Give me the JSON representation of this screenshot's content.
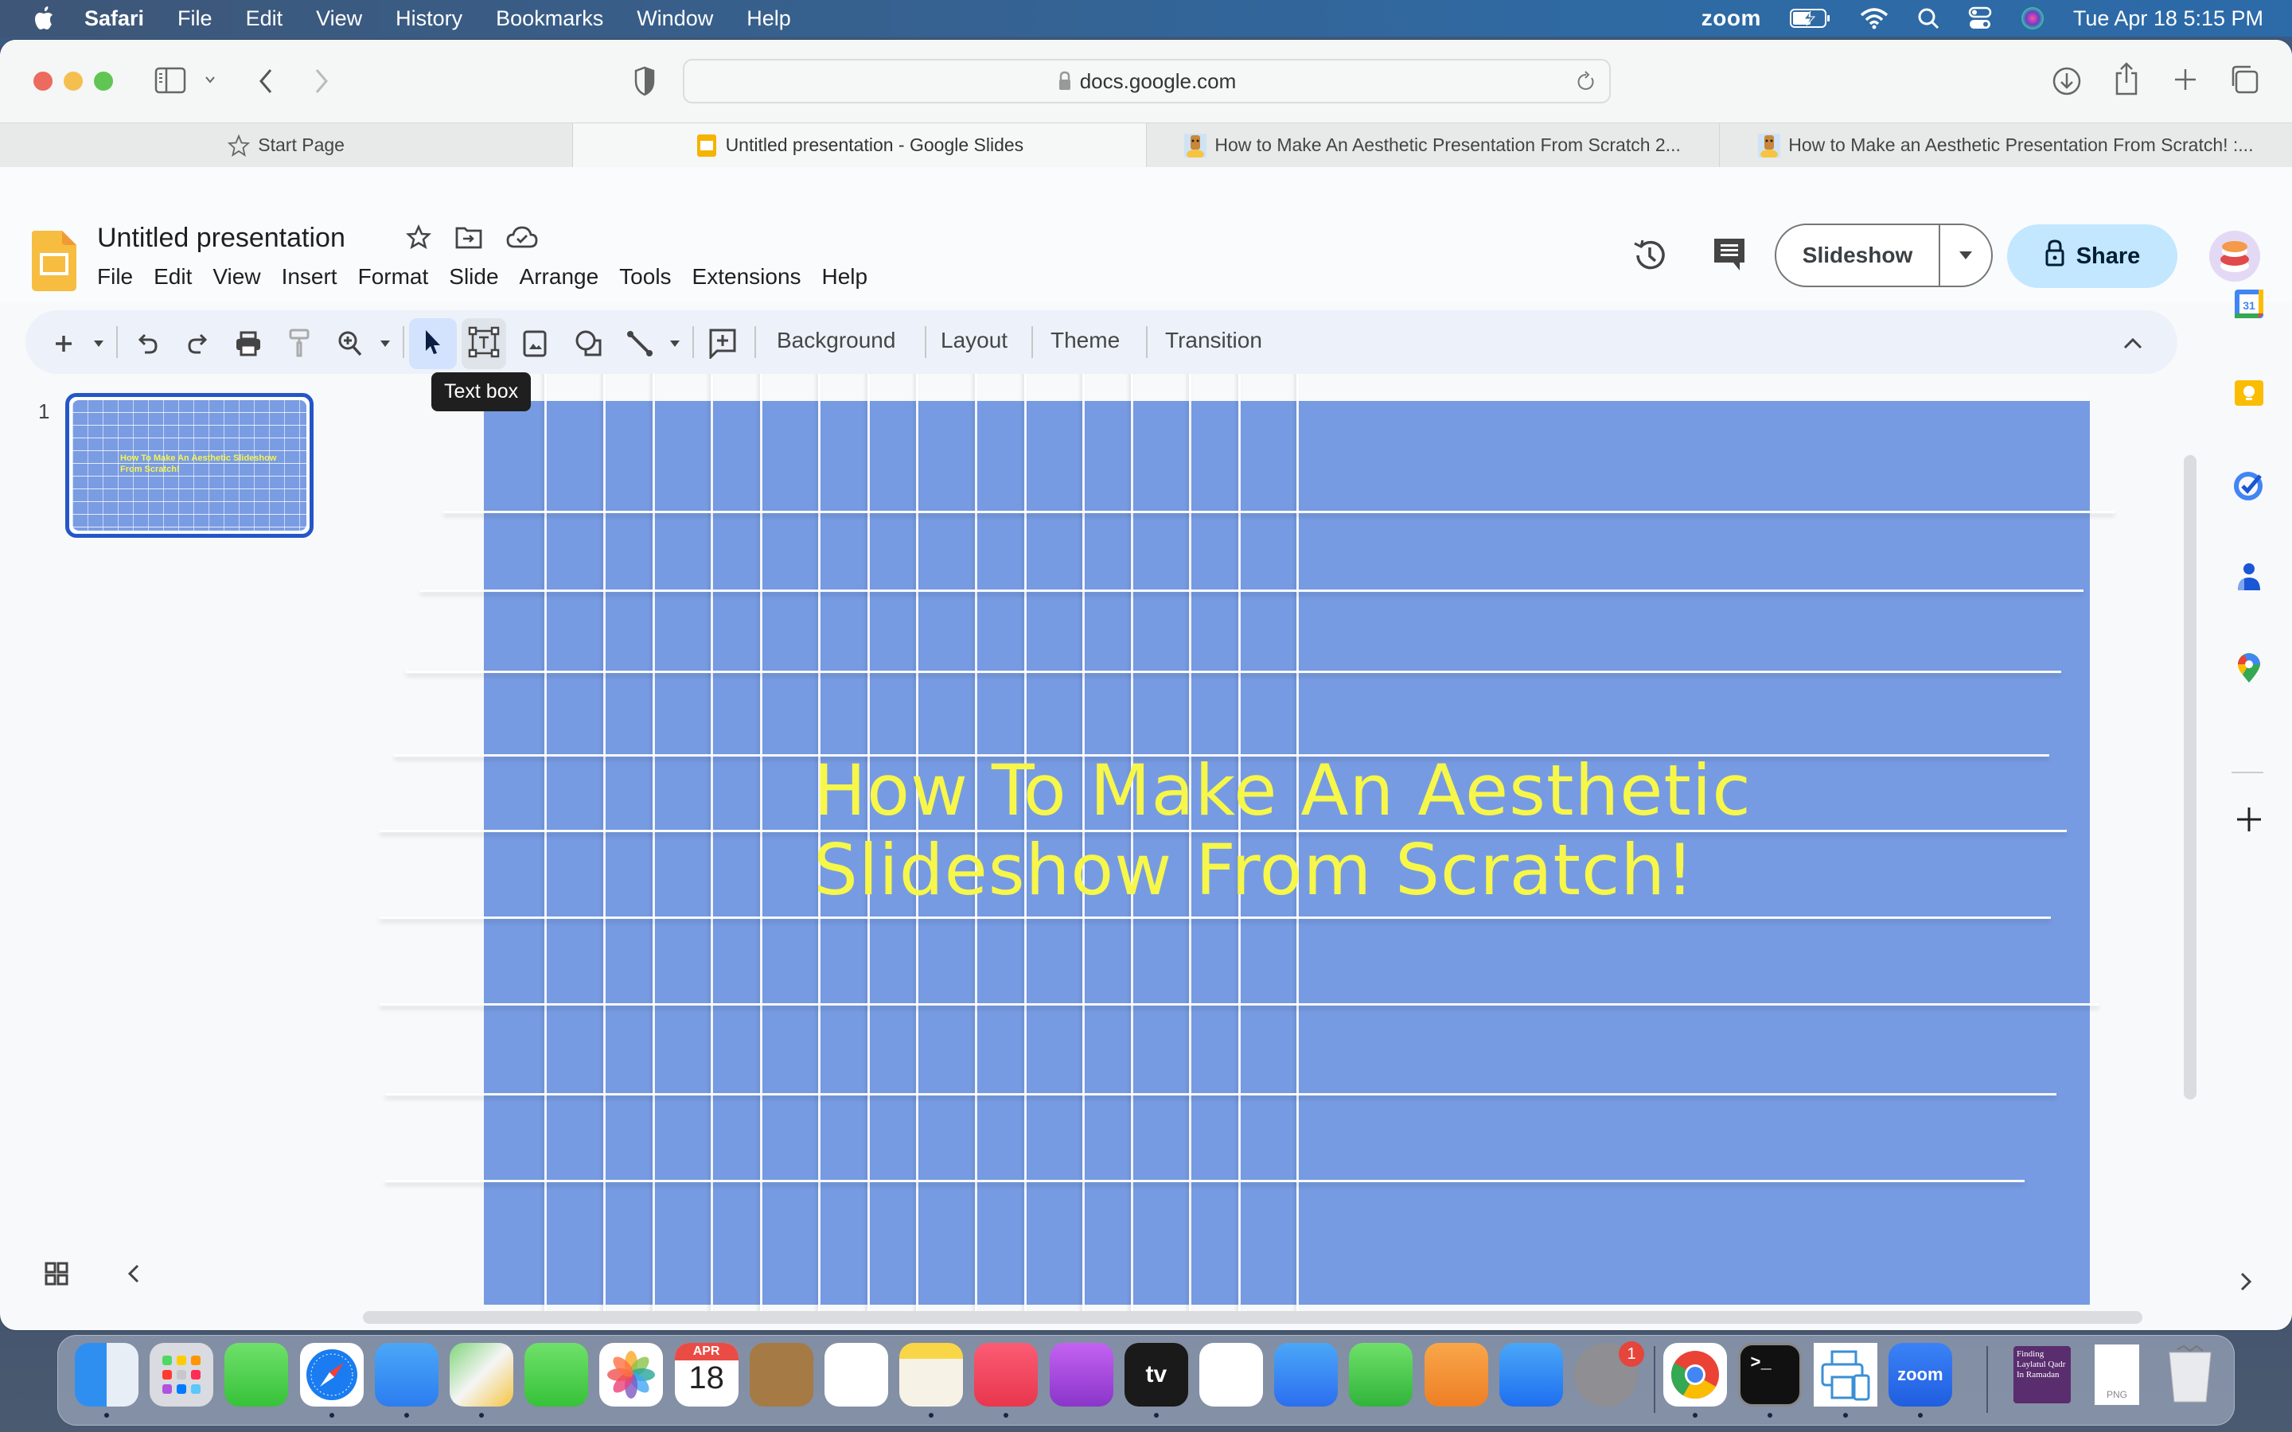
{
  "menubar": {
    "app_name": "Safari",
    "items": [
      "File",
      "Edit",
      "View",
      "History",
      "Bookmarks",
      "Window",
      "Help"
    ],
    "status": {
      "zoom_label": "zoom",
      "datetime": "Tue Apr 18  5:15 PM"
    }
  },
  "browser": {
    "url": "docs.google.com",
    "tabs": [
      {
        "label": "Start Page",
        "icon": "star-icon",
        "active": false
      },
      {
        "label": "Untitled presentation - Google Slides",
        "icon": "google-slides-icon",
        "active": true
      },
      {
        "label": "How to Make An Aesthetic Presentation From Scratch 2...",
        "icon": "video-thumbnail-icon",
        "active": false
      },
      {
        "label": "How to Make an Aesthetic Presentation From Scratch! :...",
        "icon": "video-thumbnail-icon",
        "active": false
      }
    ]
  },
  "slides_app": {
    "doc_title": "Untitled presentation",
    "menu": [
      "File",
      "Edit",
      "View",
      "Insert",
      "Format",
      "Slide",
      "Arrange",
      "Tools",
      "Extensions",
      "Help"
    ],
    "slideshow_label": "Slideshow",
    "share_label": "Share",
    "toolbar": {
      "text_buttons": [
        "Background",
        "Layout",
        "Theme",
        "Transition"
      ],
      "tooltip": "Text box",
      "selected_tool": "select",
      "hovered_tool": "text-box"
    },
    "filmstrip": {
      "slides": [
        {
          "number": "1",
          "title": "How To  Make An Aesthetic Slideshow From Scratch!"
        }
      ]
    },
    "current_slide": {
      "title_line1": "How To  Make An Aesthetic",
      "title_line2": "Slideshow From Scratch!",
      "background_color": "#779be2",
      "title_color": "#f7f74a"
    },
    "side_panel": [
      "calendar",
      "keep",
      "tasks",
      "contacts",
      "maps"
    ]
  },
  "dock": {
    "apps": [
      {
        "name": "Finder",
        "running": true
      },
      {
        "name": "Launchpad",
        "running": false
      },
      {
        "name": "Messages",
        "running": false
      },
      {
        "name": "Safari",
        "running": true
      },
      {
        "name": "Mail",
        "running": true
      },
      {
        "name": "Maps",
        "running": true
      },
      {
        "name": "FaceTime",
        "running": false
      },
      {
        "name": "Photos",
        "running": false
      },
      {
        "name": "Calendar",
        "running": false,
        "month": "APR",
        "day": "18"
      },
      {
        "name": "Contacts",
        "running": false
      },
      {
        "name": "Reminders",
        "running": false
      },
      {
        "name": "Notes",
        "running": true
      },
      {
        "name": "Music",
        "running": true
      },
      {
        "name": "Podcasts",
        "running": false
      },
      {
        "name": "TV",
        "running": true,
        "label": "tv"
      },
      {
        "name": "News",
        "running": false
      },
      {
        "name": "Keynote",
        "running": false
      },
      {
        "name": "Numbers",
        "running": false
      },
      {
        "name": "Pages",
        "running": false
      },
      {
        "name": "App Store",
        "running": false
      },
      {
        "name": "System Preferences",
        "running": false,
        "badge": "1"
      },
      {
        "name": "Chrome",
        "running": true
      },
      {
        "name": "Terminal",
        "running": true
      },
      {
        "name": "Printer",
        "running": true
      },
      {
        "name": "Zoom",
        "running": true,
        "label": "zoom"
      }
    ],
    "stack_label": "Finding Laylatul Qadr In Ramadan",
    "file_label": "PNG"
  }
}
